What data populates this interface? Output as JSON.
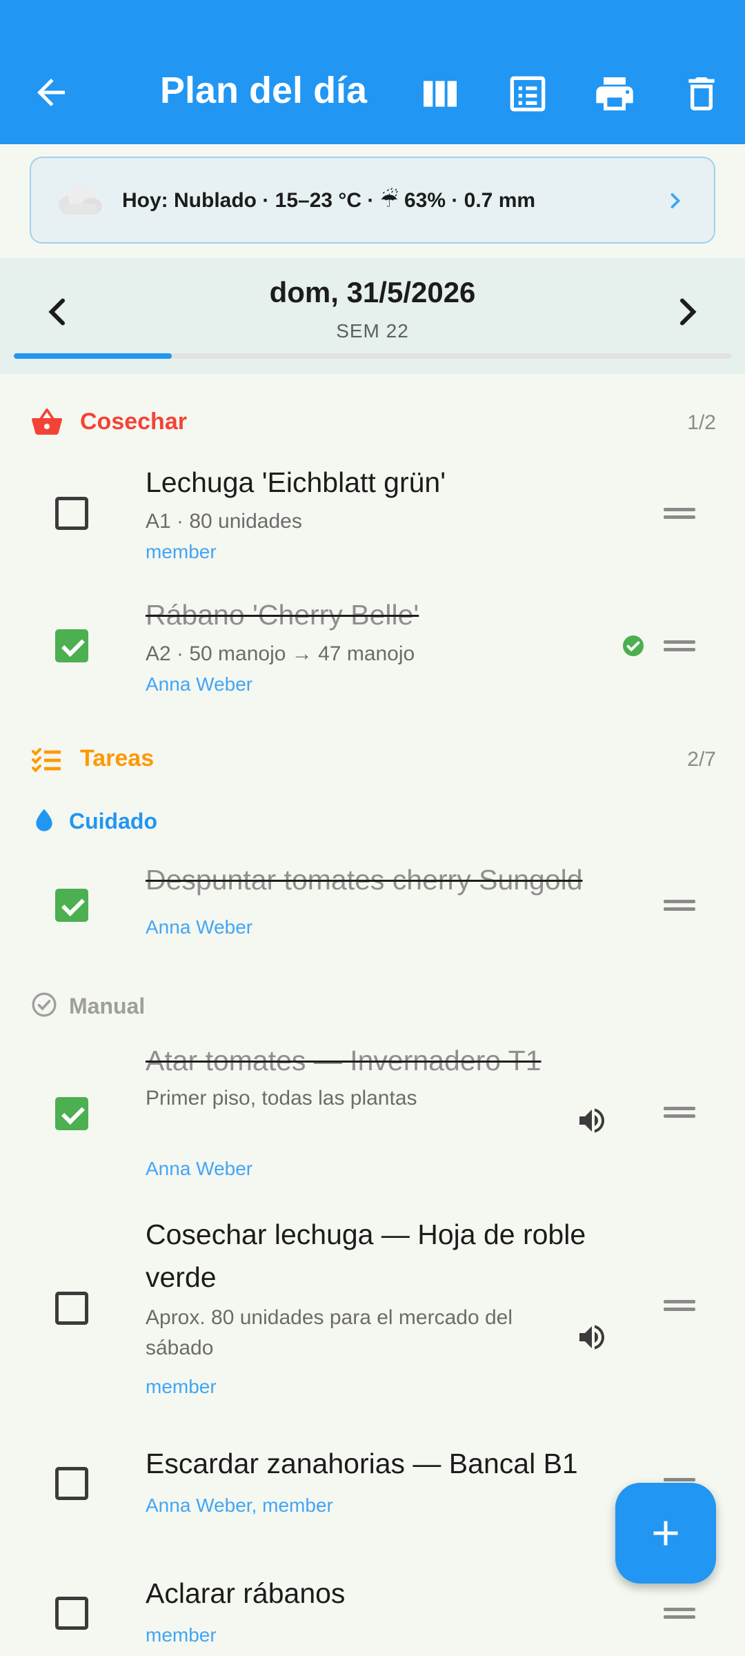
{
  "appbar": {
    "title": "Plan del día",
    "icons": [
      "back-arrow-icon",
      "view-columns-icon",
      "list-view-icon",
      "print-icon",
      "delete-icon"
    ]
  },
  "weather": {
    "icon": "cloud-icon",
    "text": "Hoy: Nublado · 15–23 °C · ☔ 63% · 0.7 mm"
  },
  "date_nav": {
    "date": "dom, 31/5/2026",
    "week": "SEM 22",
    "progress_fraction": 0.22
  },
  "sections": {
    "harvest": {
      "label": "Cosechar",
      "count": "1/2",
      "color": "#f44336"
    },
    "tasks": {
      "label": "Tareas",
      "count": "2/7",
      "color": "#ff9800"
    },
    "care": {
      "label": "Cuidado",
      "color": "#2196f3"
    },
    "manual": {
      "label": "Manual",
      "color": "#9e9e9e"
    }
  },
  "harvest_items": [
    {
      "title": "Lechuga 'Eichblatt grün'",
      "sub": "A1 · 80 unidades",
      "user": "member",
      "checked": false
    },
    {
      "title": "Rábano 'Cherry Belle'",
      "sub": "A2 · 50 manojo → 47 manojo",
      "user": "Anna Weber",
      "checked": true
    }
  ],
  "care_items": [
    {
      "title": "Despuntar tomates cherry Sungold",
      "user": "Anna Weber",
      "checked": true
    }
  ],
  "manual_items": [
    {
      "title": "Atar tomates — Invernadero T1",
      "sub": "Primer piso, todas las plantas",
      "user": "Anna Weber",
      "checked": true
    },
    {
      "title_line1": "Cosechar lechuga — Hoja de roble",
      "title_line2": "verde",
      "sub_line1": "Aprox. 80 unidades para el mercado del",
      "sub_line2": "sábado",
      "user": "member",
      "checked": false
    },
    {
      "title": "Escardar zanahorias — Bancal B1",
      "user": "Anna Weber, member",
      "checked": false
    },
    {
      "title": "Aclarar rábanos",
      "user": "member",
      "checked": false
    }
  ],
  "colors": {
    "primary": "#2196f3",
    "checked": "#4caf50",
    "link": "#42a5f5",
    "background": "#f5f8f1"
  }
}
